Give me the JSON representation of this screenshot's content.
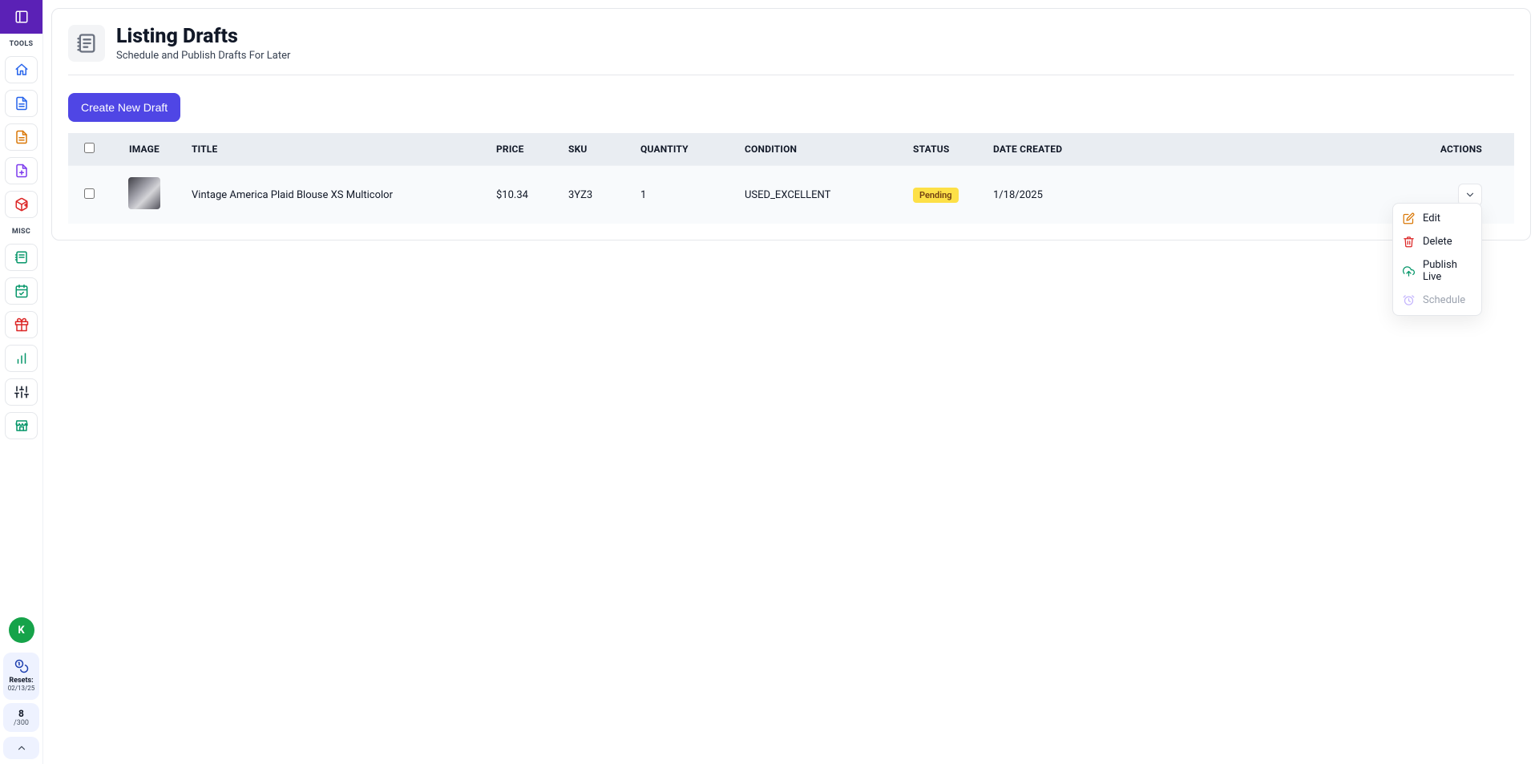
{
  "sidebar": {
    "section_tools": "TOOLS",
    "section_misc": "MISC",
    "avatar_letter": "K",
    "resets_label": "Resets:",
    "resets_date": "02/13/25",
    "count_value": "8",
    "count_total": "/300"
  },
  "header": {
    "title": "Listing Drafts",
    "subtitle": "Schedule and Publish Drafts For Later"
  },
  "buttons": {
    "create": "Create New Draft"
  },
  "table": {
    "columns": {
      "image": "IMAGE",
      "title": "TITLE",
      "price": "PRICE",
      "sku": "SKU",
      "quantity": "QUANTITY",
      "condition": "CONDITION",
      "status": "STATUS",
      "date_created": "DATE CREATED",
      "actions": "ACTIONS"
    },
    "rows": [
      {
        "title": "Vintage America Plaid Blouse XS Multicolor",
        "price": "$10.34",
        "sku": "3YZ3",
        "quantity": "1",
        "condition": "USED_EXCELLENT",
        "status": "Pending",
        "date_created": "1/18/2025"
      }
    ]
  },
  "dropdown": {
    "edit": "Edit",
    "delete": "Delete",
    "publish": "Publish Live",
    "schedule": "Schedule"
  }
}
